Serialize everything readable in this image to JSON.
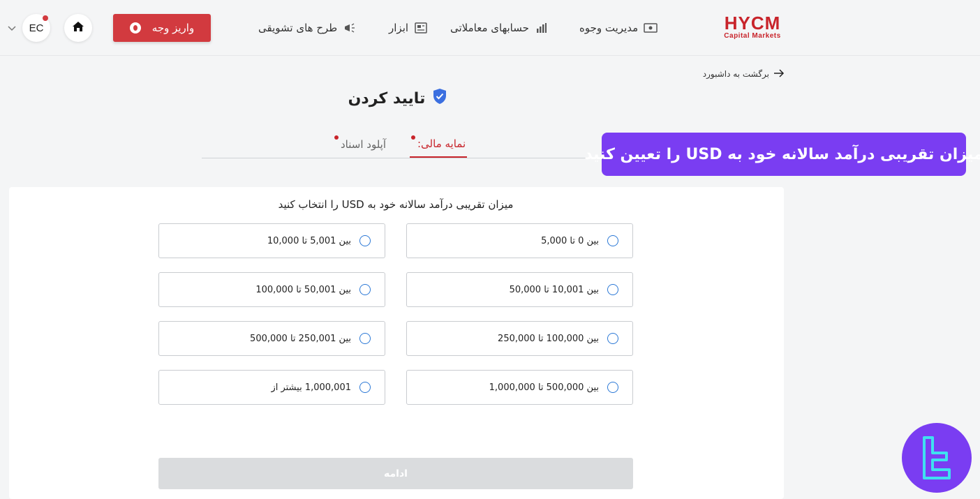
{
  "brand": {
    "name": "HYCM",
    "subtitle": "Capital Markets",
    "color": "#c8242b"
  },
  "nav": [
    {
      "label": "مدیریت وجوه",
      "icon": "cash-icon"
    },
    {
      "label": "حسابهای معاملاتی",
      "icon": "bar-chart-icon"
    },
    {
      "label": "ابزار",
      "icon": "newspaper-icon"
    },
    {
      "label": "طرح های تشویقی",
      "icon": "megaphone-icon"
    }
  ],
  "header": {
    "deposit_label": "واریز وجه",
    "user_initials": "EC"
  },
  "back_label": "برگشت به داشبورد",
  "page_title": "تایید کردن",
  "tabs": [
    {
      "label": "نمایه مالی:",
      "active": true
    },
    {
      "label": "آپلود اسناد",
      "active": false
    }
  ],
  "banner_text": "میزان تقریبی درآمد سالانه خود به USD را تعیین کنید",
  "question": "میزان تقریبی درآمد سالانه خود به USD را انتخاب کنید",
  "options": [
    "بین 0 تا 5,000",
    "بین 5,001 تا 10,000",
    "بین 10,001 تا 50,000",
    "بین 50,001 تا 100,000",
    "بین 100,000 تا 250,000",
    "بین 250,001 تا 500,000",
    "بین 500,000 تا 1,000,000",
    "1,000,001 بیشتر از"
  ],
  "continue_label": "ادامه",
  "colors": {
    "accent": "#c8242b",
    "banner": "#7a3df2",
    "radio": "#2b78d6"
  }
}
